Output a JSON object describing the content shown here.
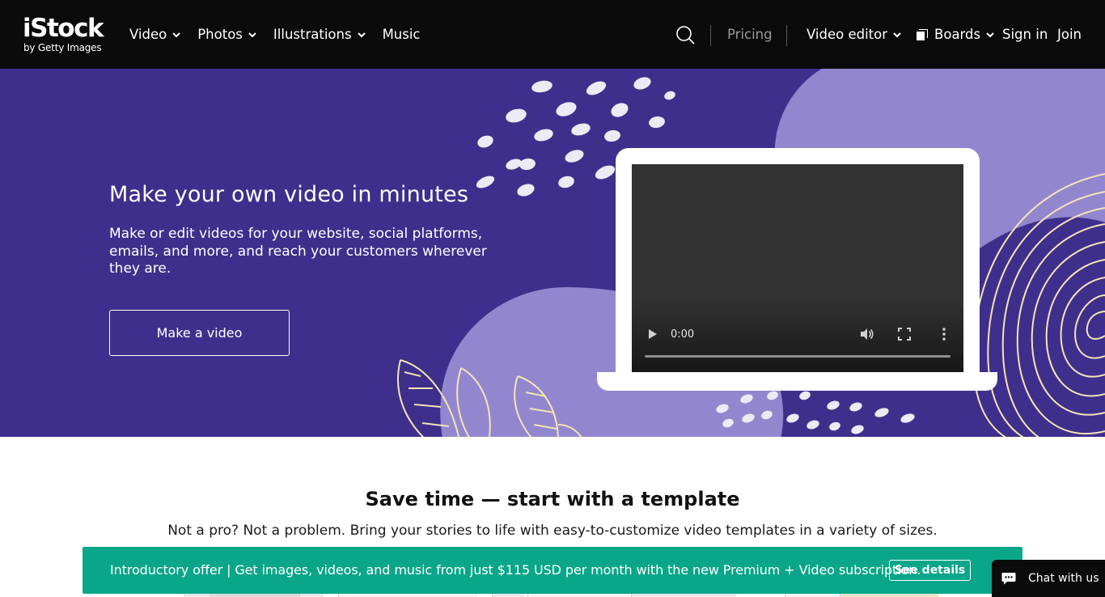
{
  "header": {
    "logo_brand": "iStock",
    "logo_sub": "by Getty Images",
    "nav_left": [
      {
        "label": "Video",
        "has_dropdown": true
      },
      {
        "label": "Photos",
        "has_dropdown": true
      },
      {
        "label": "Illustrations",
        "has_dropdown": true
      },
      {
        "label": "Music",
        "has_dropdown": false
      }
    ],
    "pricing": "Pricing",
    "video_editor": "Video editor",
    "boards": "Boards",
    "sign_in": "Sign in",
    "join": "Join",
    "icons": {
      "search": "search-icon",
      "boards": "boards-icon",
      "chevron": "chevron-down-icon"
    }
  },
  "hero": {
    "title": "Make your own video in minutes",
    "subtitle": "Make or edit videos for your website, social platforms, emails, and more, and reach your customers wherever they are.",
    "cta": "Make a video",
    "colors": {
      "background": "#3f2f8c",
      "blob": "#9287cf",
      "line_art": "#f2e6b5"
    }
  },
  "video_player": {
    "time": "0:00",
    "progress": 0,
    "icons": [
      "play-icon",
      "volume-icon",
      "fullscreen-icon",
      "more-options-icon"
    ]
  },
  "templates": {
    "title": "Save time — start with a template",
    "subtitle": "Not a pro? Not a problem. Bring your stories to life with easy-to-customize video templates in a variety of sizes."
  },
  "promo": {
    "text": "Introductory offer | Get images, videos, and music from just $115 USD per month with the new Premium + Video subscription.",
    "button": "See details",
    "color": "#0aa689"
  },
  "chat": {
    "label": "Chat with us",
    "icon": "chat-bubble-icon"
  }
}
